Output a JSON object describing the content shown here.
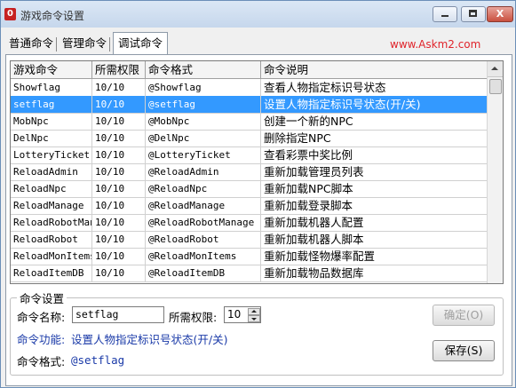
{
  "window": {
    "title": "游戏命令设置",
    "minimize_glyph": "",
    "maximize_glyph": "",
    "close_glyph": "X"
  },
  "tabs": [
    {
      "label": "普通命令"
    },
    {
      "label": "管理命令"
    },
    {
      "label": "调试命令"
    }
  ],
  "site_link": "www.Askm2.com",
  "table": {
    "headers": [
      "游戏命令",
      "所需权限",
      "命令格式",
      "命令说明"
    ],
    "rows": [
      {
        "cmd": "Showflag",
        "perm": "10/10",
        "format": "@Showflag",
        "desc": "查看人物指定标识号状态"
      },
      {
        "cmd": "setflag",
        "perm": "10/10",
        "format": "@setflag",
        "desc": "设置人物指定标识号状态(开/关)"
      },
      {
        "cmd": "MobNpc",
        "perm": "10/10",
        "format": "@MobNpc",
        "desc": "创建一个新的NPC"
      },
      {
        "cmd": "DelNpc",
        "perm": "10/10",
        "format": "@DelNpc",
        "desc": "删除指定NPC"
      },
      {
        "cmd": "LotteryTicket",
        "perm": "10/10",
        "format": "@LotteryTicket",
        "desc": "查看彩票中奖比例"
      },
      {
        "cmd": "ReloadAdmin",
        "perm": "10/10",
        "format": "@ReloadAdmin",
        "desc": "重新加载管理员列表"
      },
      {
        "cmd": "ReloadNpc",
        "perm": "10/10",
        "format": "@ReloadNpc",
        "desc": "重新加载NPC脚本"
      },
      {
        "cmd": "ReloadManage",
        "perm": "10/10",
        "format": "@ReloadManage",
        "desc": "重新加载登录脚本"
      },
      {
        "cmd": "ReloadRobotManage",
        "perm": "10/10",
        "format": "@ReloadRobotManage",
        "desc": "重新加载机器人配置"
      },
      {
        "cmd": "ReloadRobot",
        "perm": "10/10",
        "format": "@ReloadRobot",
        "desc": "重新加载机器人脚本"
      },
      {
        "cmd": "ReloadMonItems",
        "perm": "10/10",
        "format": "@ReloadMonItems",
        "desc": "重新加载怪物爆率配置"
      },
      {
        "cmd": "ReloadItemDB",
        "perm": "10/10",
        "format": "@ReloadItemDB",
        "desc": "重新加载物品数据库"
      }
    ]
  },
  "settings": {
    "group_title": "命令设置",
    "name_label": "命令名称:",
    "name_value": "setflag",
    "perm_label": "所需权限:",
    "perm_value": "10",
    "function_label": "命令功能:",
    "function_value": "设置人物指定标识号状态(开/关)",
    "format_label": "命令格式:",
    "format_value": "@setflag",
    "confirm_label": "确定(O)",
    "save_label": "保存(S)"
  },
  "colors": {
    "selection": "#3399ff",
    "link": "#e0242b",
    "info_text": "#1a3aa8"
  },
  "selected_row_index": 1
}
